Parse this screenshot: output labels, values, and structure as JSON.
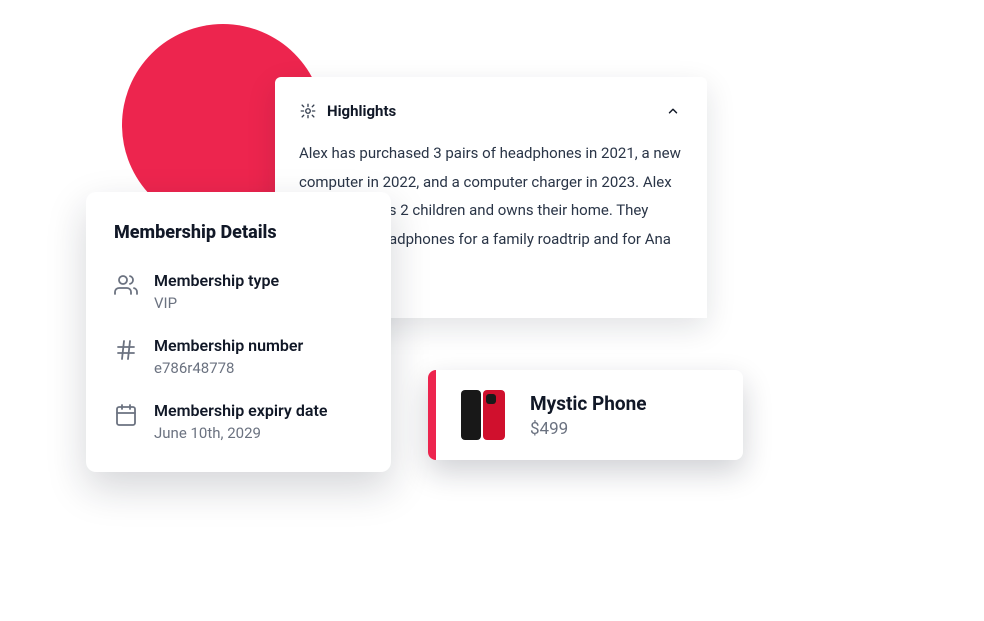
{
  "highlights": {
    "title": "Highlights",
    "body": "Alex has purchased 3 pairs of headphones in 2021, a new computer in 2022, and a computer charger in 2023. Alex is married, has 2 children and owns their home. They purchased headphones for a family roadtrip and for Ana"
  },
  "membership": {
    "title": "Membership Details",
    "items": [
      {
        "label": "Membership type",
        "value": "VIP"
      },
      {
        "label": "Membership number",
        "value": "e786r48778"
      },
      {
        "label": "Membership expiry date",
        "value": "June 10th, 2029"
      }
    ]
  },
  "product": {
    "name": "Mystic Phone",
    "price": "$499"
  },
  "colors": {
    "accent": "#ed254e"
  }
}
